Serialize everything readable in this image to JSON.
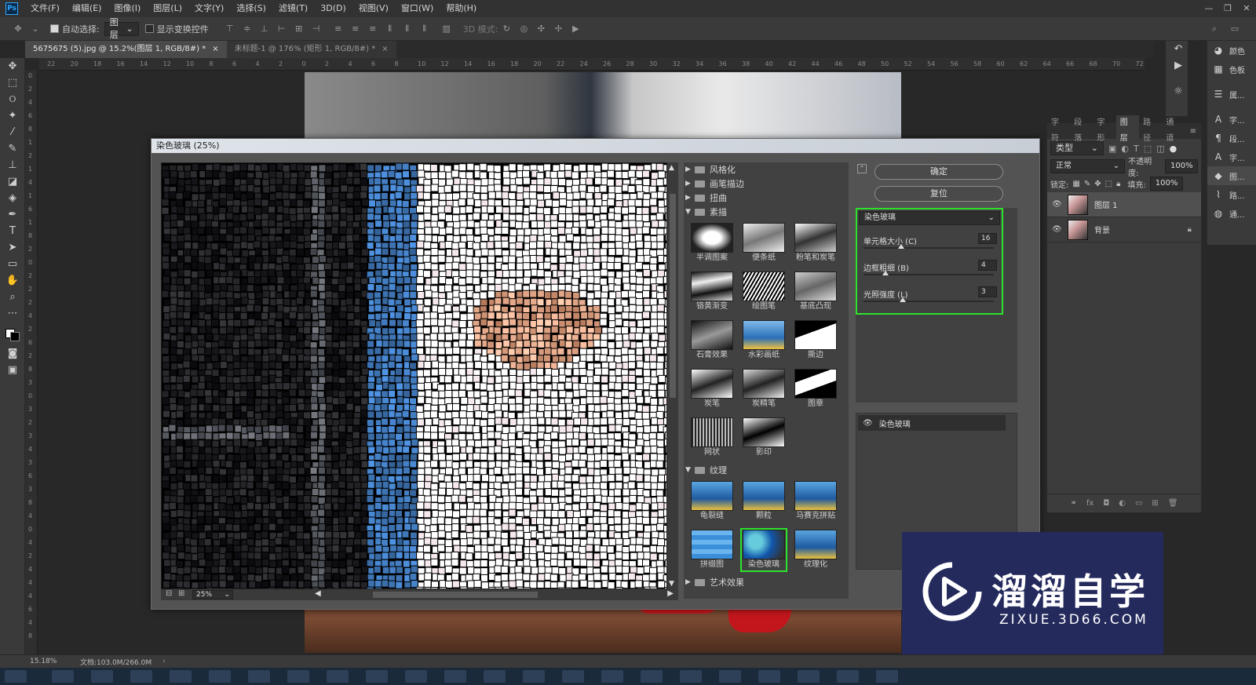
{
  "app": {
    "logo": "Ps"
  },
  "menu": [
    "文件(F)",
    "编辑(E)",
    "图像(I)",
    "图层(L)",
    "文字(Y)",
    "选择(S)",
    "滤镜(T)",
    "3D(D)",
    "视图(V)",
    "窗口(W)",
    "帮助(H)"
  ],
  "window_controls": [
    "—",
    "❐",
    "✕"
  ],
  "options": {
    "auto_select_label": "自动选择:",
    "auto_select_value": "图层",
    "show_transform_label": "显示变换控件",
    "mode_3d_label": "3D 模式:"
  },
  "tabs": [
    {
      "label": "5675675 (5).jpg @ 15.2%(图层 1, RGB/8#) *"
    },
    {
      "label": "未标题-1 @ 176% (矩形 1, RGB/8#) *"
    }
  ],
  "ruler_h": [
    "22",
    "20",
    "18",
    "16",
    "14",
    "12",
    "10",
    "8",
    "6",
    "4",
    "2",
    "0",
    "2",
    "4",
    "6",
    "8",
    "10",
    "12",
    "14",
    "16",
    "18",
    "20",
    "22",
    "24",
    "26",
    "28",
    "30",
    "32",
    "34",
    "36",
    "38",
    "40",
    "42",
    "44",
    "46",
    "48",
    "50",
    "52",
    "54",
    "56",
    "58",
    "60",
    "62",
    "64",
    "66",
    "68",
    "70",
    "72"
  ],
  "ruler_v": [
    "0",
    "2",
    "4",
    "6",
    "8",
    "1",
    "2",
    "1",
    "4",
    "1",
    "6",
    "1",
    "8",
    "2",
    "0",
    "2",
    "2",
    "2",
    "4",
    "2",
    "6",
    "2",
    "8",
    "3",
    "0",
    "3",
    "2",
    "3",
    "4",
    "3",
    "6",
    "3",
    "8",
    "4",
    "0",
    "4",
    "2",
    "4",
    "4",
    "4",
    "6",
    "4",
    "8"
  ],
  "status": {
    "zoom": "15.18%",
    "doc": "文档:103.0M/266.0M"
  },
  "dialog": {
    "title": "染色玻璃 (25%)",
    "zoom": "25%",
    "ok": "确定",
    "reset": "复位",
    "filter_select": "染色玻璃",
    "params": [
      {
        "label": "单元格大小 (C)",
        "value": "16",
        "pos": 0.29
      },
      {
        "label": "边框粗细 (B)",
        "value": "4",
        "pos": 0.17
      },
      {
        "label": "光照强度 (L)",
        "value": "3",
        "pos": 0.3
      }
    ],
    "effect_layer": "染色玻璃",
    "categories": {
      "stylize": "风格化",
      "brush": "画笔描边",
      "distort": "扭曲",
      "sketch": "素描",
      "texture": "纹理",
      "artistic": "艺术效果"
    },
    "sketch_filters": [
      "半调图案",
      "便条纸",
      "粉笔和炭笔",
      "铬黄渐变",
      "绘图笔",
      "基底凸现",
      "石膏效果",
      "水彩画纸",
      "撕边",
      "炭笔",
      "炭精笔",
      "图章",
      "网状",
      "影印"
    ],
    "texture_filters": [
      "龟裂缝",
      "颗粒",
      "马赛克拼贴",
      "拼缀图",
      "染色玻璃",
      "纹理化"
    ]
  },
  "layers": {
    "tabs": [
      "字符",
      "段落",
      "字形",
      "图层",
      "路径",
      "通道"
    ],
    "filter": "类型",
    "blend": "正常",
    "opacity_label": "不透明度:",
    "opacity": "100%",
    "lock_label": "锁定:",
    "fill_label": "填充:",
    "fill": "100%",
    "items": [
      {
        "name": "图层 1",
        "selected": true
      },
      {
        "name": "背景",
        "selected": false
      }
    ]
  },
  "right_panel": [
    "颜色",
    "色板",
    "属...",
    "字...",
    "段...",
    "字...",
    "图...",
    "路...",
    "通..."
  ],
  "watermark": {
    "title": "溜溜自学",
    "url": "ZIXUE.3D66.COM"
  },
  "colors": {
    "accent_green": "#2ee32e",
    "ps_blue": "#31a8ff"
  }
}
